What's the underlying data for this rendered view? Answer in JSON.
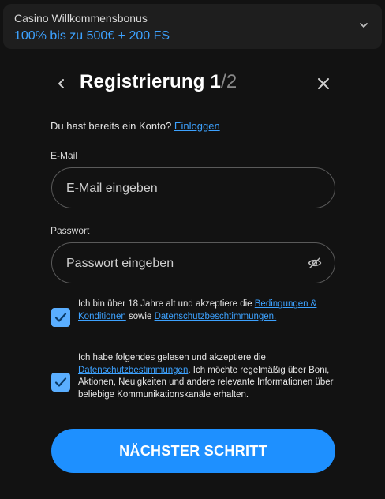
{
  "bonus": {
    "title": "Casino Willkommensbonus",
    "offer": "100% bis zu 500€ + 200 FS",
    "icon": "chevron-down-icon"
  },
  "header": {
    "title": "Registrierung 1",
    "step_total": "/2",
    "back_icon": "chevron-left-icon",
    "close_icon": "close-icon"
  },
  "login": {
    "prompt": "Du hast bereits ein Konto?",
    "link": "Einloggen"
  },
  "email": {
    "label": "E-Mail",
    "placeholder": "E-Mail eingeben"
  },
  "password": {
    "label": "Passwort",
    "placeholder": "Passwort eingeben",
    "icon": "eye-off-icon"
  },
  "consent_terms": {
    "checked": true,
    "text_before": "Ich bin über 18 Jahre alt und akzeptiere die",
    "link_terms": "Bedingungen & Konditionen",
    "text_middle": "sowie",
    "link_privacy": "Datenschutzbeschtimmungen."
  },
  "consent_marketing": {
    "checked": true,
    "text_before": "Ich habe folgendes gelesen und akzeptiere die",
    "link_privacy": "Datenschutzbestimmungen",
    "text_after": ". Ich möchte regelmäßig über Boni, Aktionen, Neuigkeiten und andere relevante Informationen über beliebige Kommunikationskanäle erhalten."
  },
  "submit_label": "NÄCHSTER SCHRITT",
  "colors": {
    "background": "#121212",
    "panel": "#1e1e1e",
    "accent": "#1e90ff",
    "link": "#3da2ff",
    "checkbox": "#5aaeff"
  }
}
